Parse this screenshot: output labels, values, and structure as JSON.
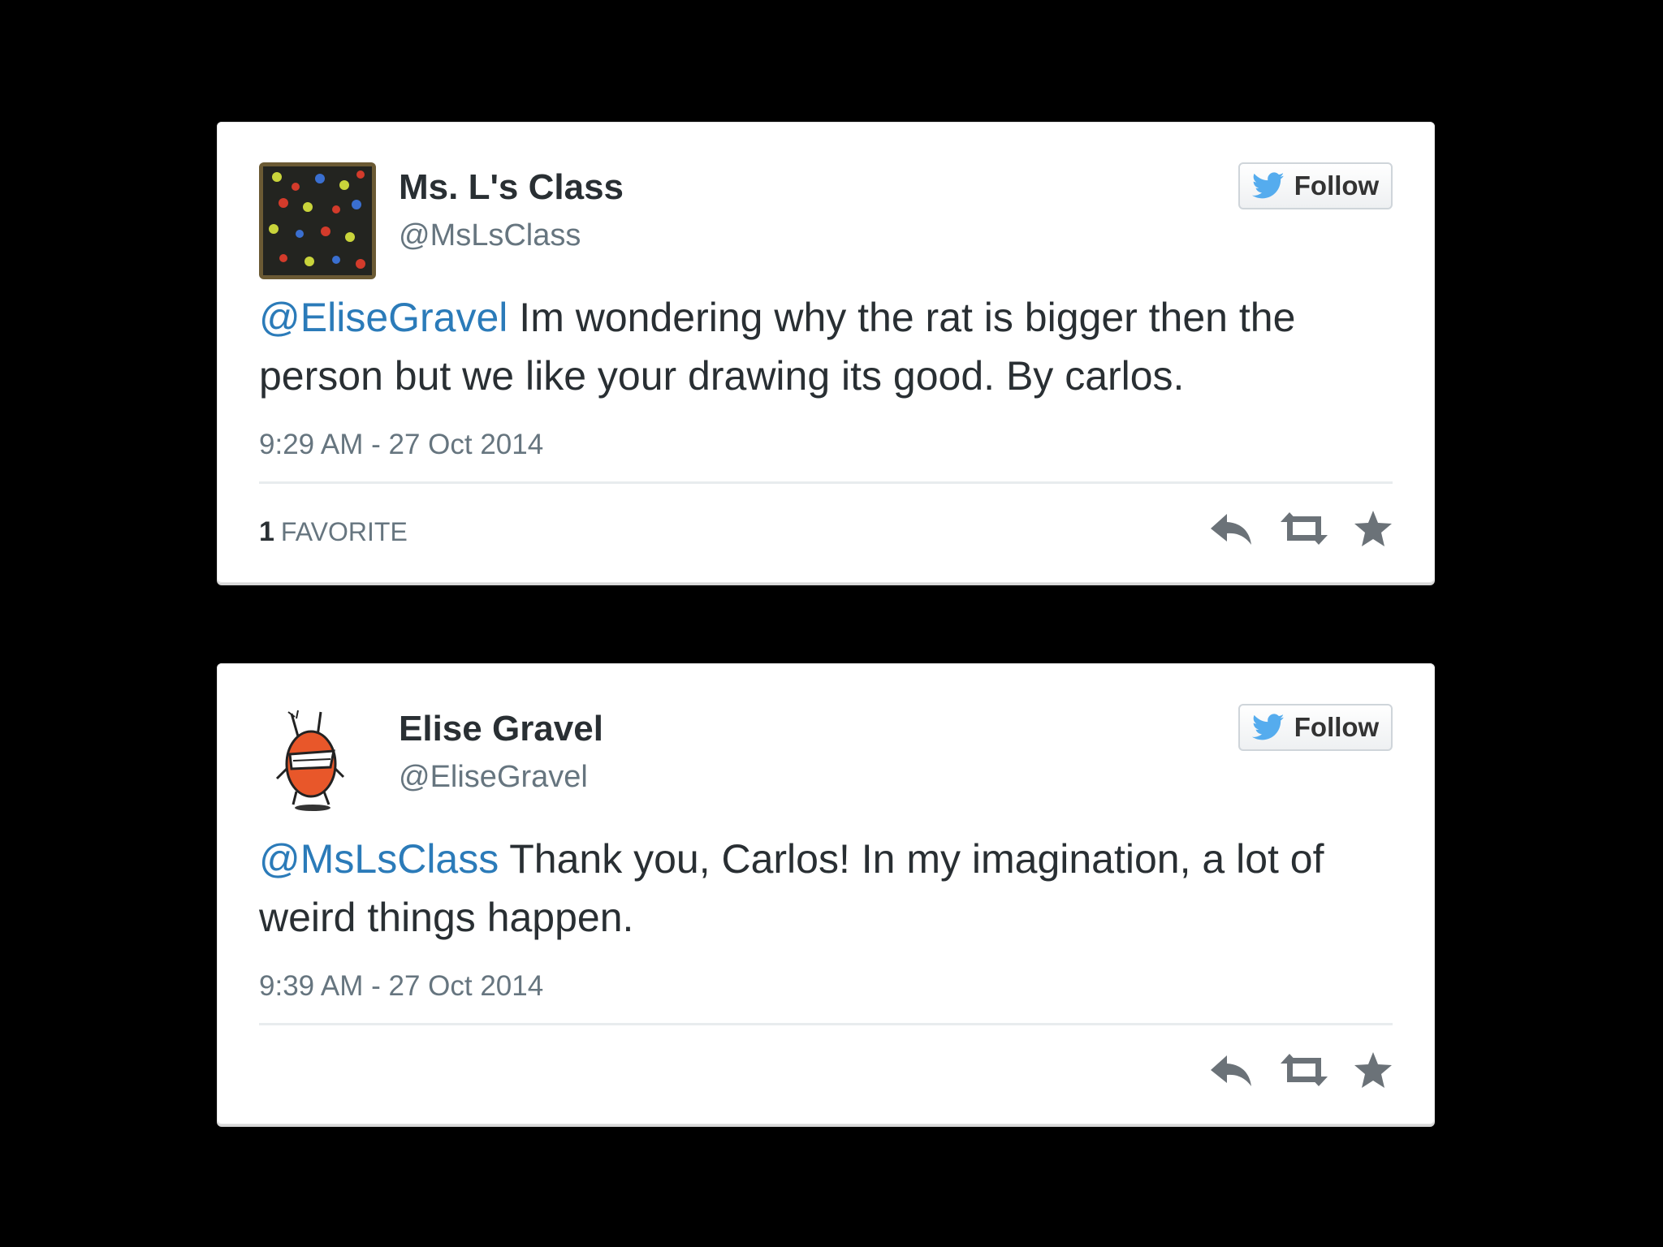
{
  "tweets": [
    {
      "display_name": "Ms. L's Class",
      "handle": "@MsLsClass",
      "follow_label": "Follow",
      "mention": "@EliseGravel",
      "body": " Im wondering why the rat is bigger then the person but we like your drawing its good. By carlos.",
      "timestamp": "9:29 AM - 27 Oct 2014",
      "favorites_count": "1",
      "favorites_label": "Favorite",
      "avatar": "handprints-avatar"
    },
    {
      "display_name": "Elise Gravel",
      "handle": "@EliseGravel",
      "follow_label": "Follow",
      "mention": "@MsLsClass",
      "body": " Thank you, Carlos! In my imagination, a lot of weird things happen.",
      "timestamp": "9:39 AM - 27 Oct 2014",
      "avatar": "cartoon-monster-avatar"
    }
  ],
  "icons": {
    "follow": "twitter-bird-icon",
    "reply": "reply-icon",
    "retweet": "retweet-icon",
    "favorite": "star-icon"
  },
  "colors": {
    "background": "#000000",
    "card": "#ffffff",
    "mention": "#2b7bb9",
    "twitter_blue": "#55acee",
    "muted": "#66757f"
  }
}
